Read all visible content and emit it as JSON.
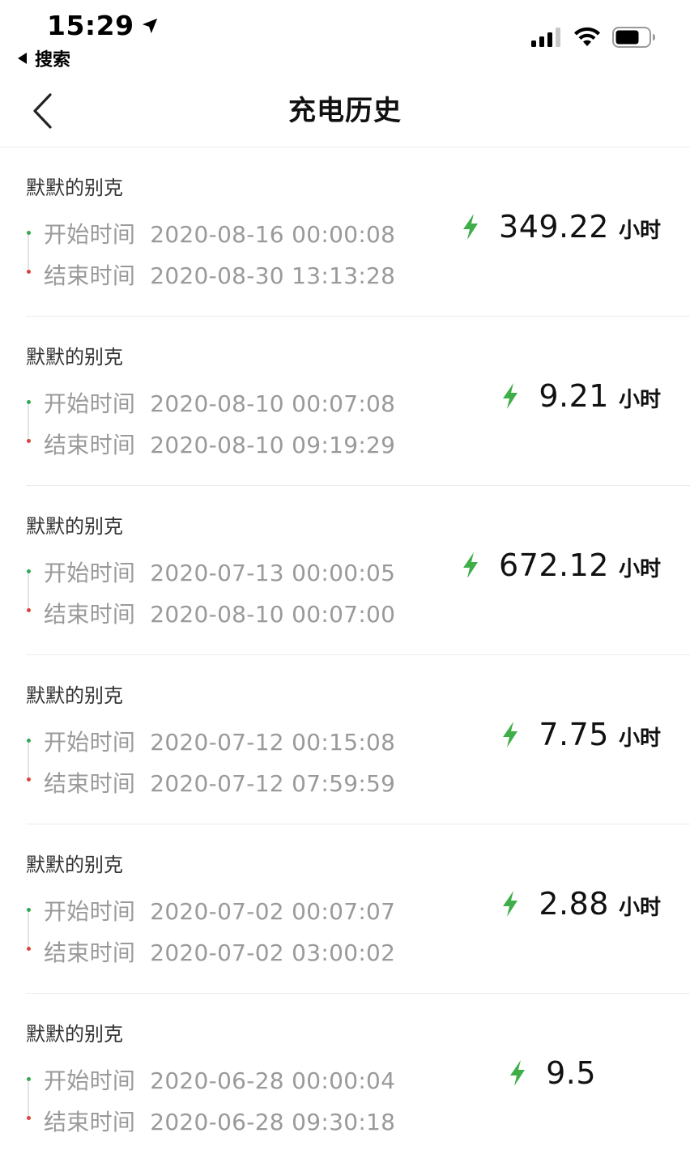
{
  "status_bar": {
    "time": "15:29",
    "back_app": "搜索"
  },
  "nav": {
    "title": "充电历史"
  },
  "labels": {
    "start": "开始时间",
    "end": "结束时间"
  },
  "colors": {
    "bolt": "#3fae49",
    "start_dot": "#34a853",
    "end_dot": "#d9453c"
  },
  "records": [
    {
      "device": "默默的别克",
      "start": "2020-08-16 00:00:08",
      "end": "2020-08-30 13:13:28",
      "duration": "349.22",
      "unit": "小时"
    },
    {
      "device": "默默的别克",
      "start": "2020-08-10 00:07:08",
      "end": "2020-08-10 09:19:29",
      "duration": "9.21",
      "unit": "小时"
    },
    {
      "device": "默默的别克",
      "start": "2020-07-13 00:00:05",
      "end": "2020-08-10 00:07:00",
      "duration": "672.12",
      "unit": "小时"
    },
    {
      "device": "默默的别克",
      "start": "2020-07-12 00:15:08",
      "end": "2020-07-12 07:59:59",
      "duration": "7.75",
      "unit": "小时"
    },
    {
      "device": "默默的别克",
      "start": "2020-07-02 00:07:07",
      "end": "2020-07-02 03:00:02",
      "duration": "2.88",
      "unit": "小时"
    },
    {
      "device": "默默的别克",
      "start": "2020-06-28 00:00:04",
      "end": "2020-06-28 09:30:18",
      "duration": "9.5",
      "unit": ""
    }
  ]
}
